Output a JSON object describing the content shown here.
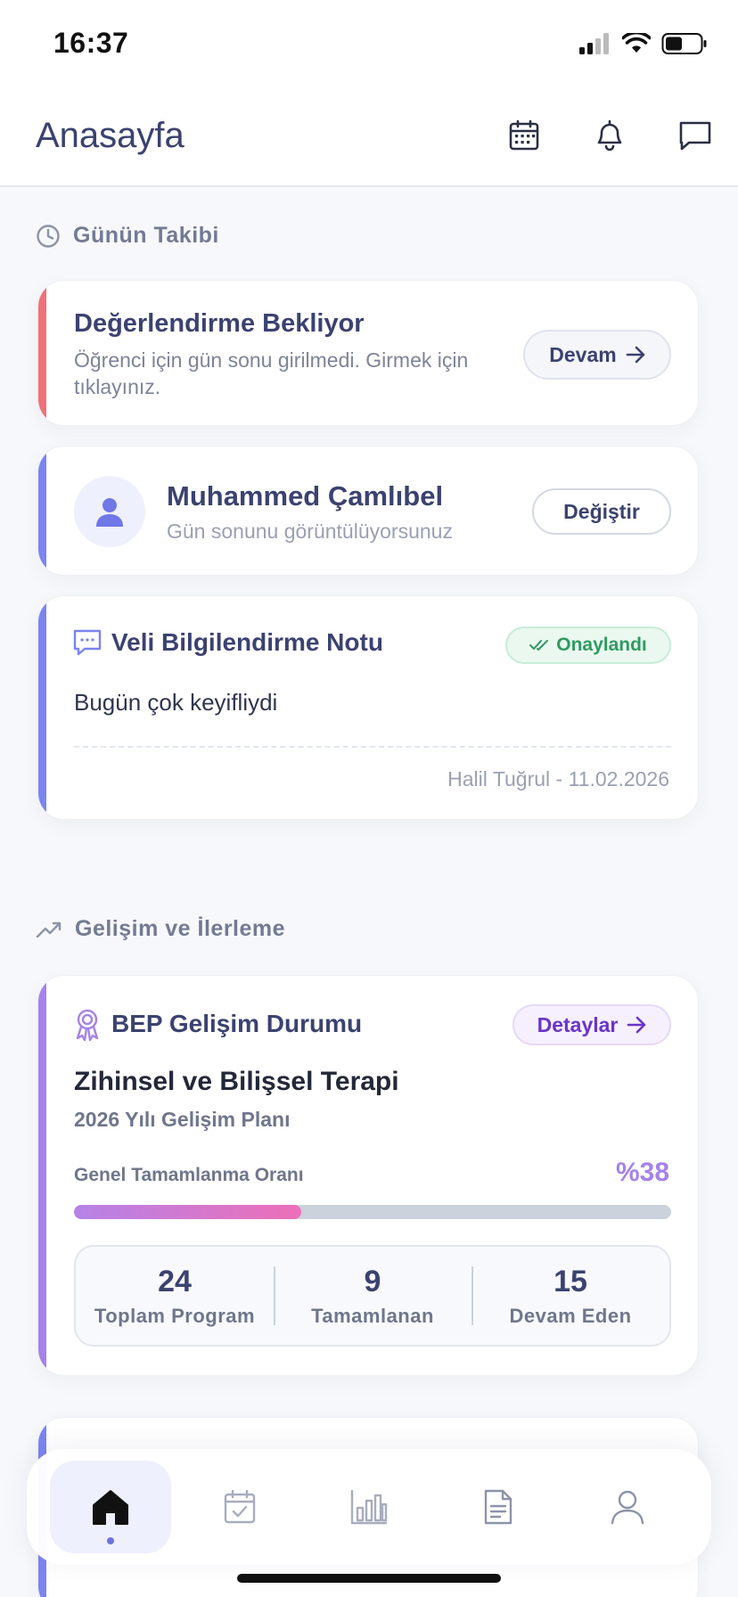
{
  "status_bar": {
    "time": "16:37"
  },
  "header": {
    "title": "Anasayfa",
    "icons": [
      "calendar-icon",
      "bell-icon",
      "chat-icon"
    ]
  },
  "daily_tracking": {
    "section_title": "Günün Takibi",
    "evaluation_card": {
      "title": "Değerlendirme Bekliyor",
      "description": "Öğrenci için gün sonu girilmedi. Girmek için tıklayınız.",
      "button_label": "Devam",
      "accent_color": "#f07178"
    },
    "student_card": {
      "name": "Muhammed Çamlıbel",
      "subtitle": "Gün sonunu görüntülüyorsunuz",
      "button_label": "Değiştir",
      "accent_color": "#7b84f0"
    },
    "parent_note_card": {
      "title": "Veli Bilgilendirme Notu",
      "badge": "Onaylandı",
      "note": "Bugün çok keyifliydi",
      "footer": "Halil Tuğrul - 11.02.2026",
      "accent_color": "#7b84f0"
    }
  },
  "progress": {
    "section_title": "Gelişim ve İlerleme",
    "bep_card": {
      "title": "BEP Gelişim Durumu",
      "button_label": "Detaylar",
      "program_title": "Zihinsel ve Bilişsel Terapi",
      "program_subtitle": "2026 Yılı Gelişim Planı",
      "completion_label": "Genel Tamamlanma Oranı",
      "completion_text": "%38",
      "completion_fraction": 0.38,
      "accent_color": "#a582ea",
      "stats": [
        {
          "value": "24",
          "label": "Toplam Program"
        },
        {
          "value": "9",
          "label": "Tamamlanan"
        },
        {
          "value": "15",
          "label": "Devam Eden"
        }
      ]
    }
  },
  "bottom_nav": {
    "items": [
      "home-icon",
      "calendar-check-icon",
      "chart-icon",
      "document-icon",
      "profile-icon"
    ],
    "active_index": 0
  }
}
